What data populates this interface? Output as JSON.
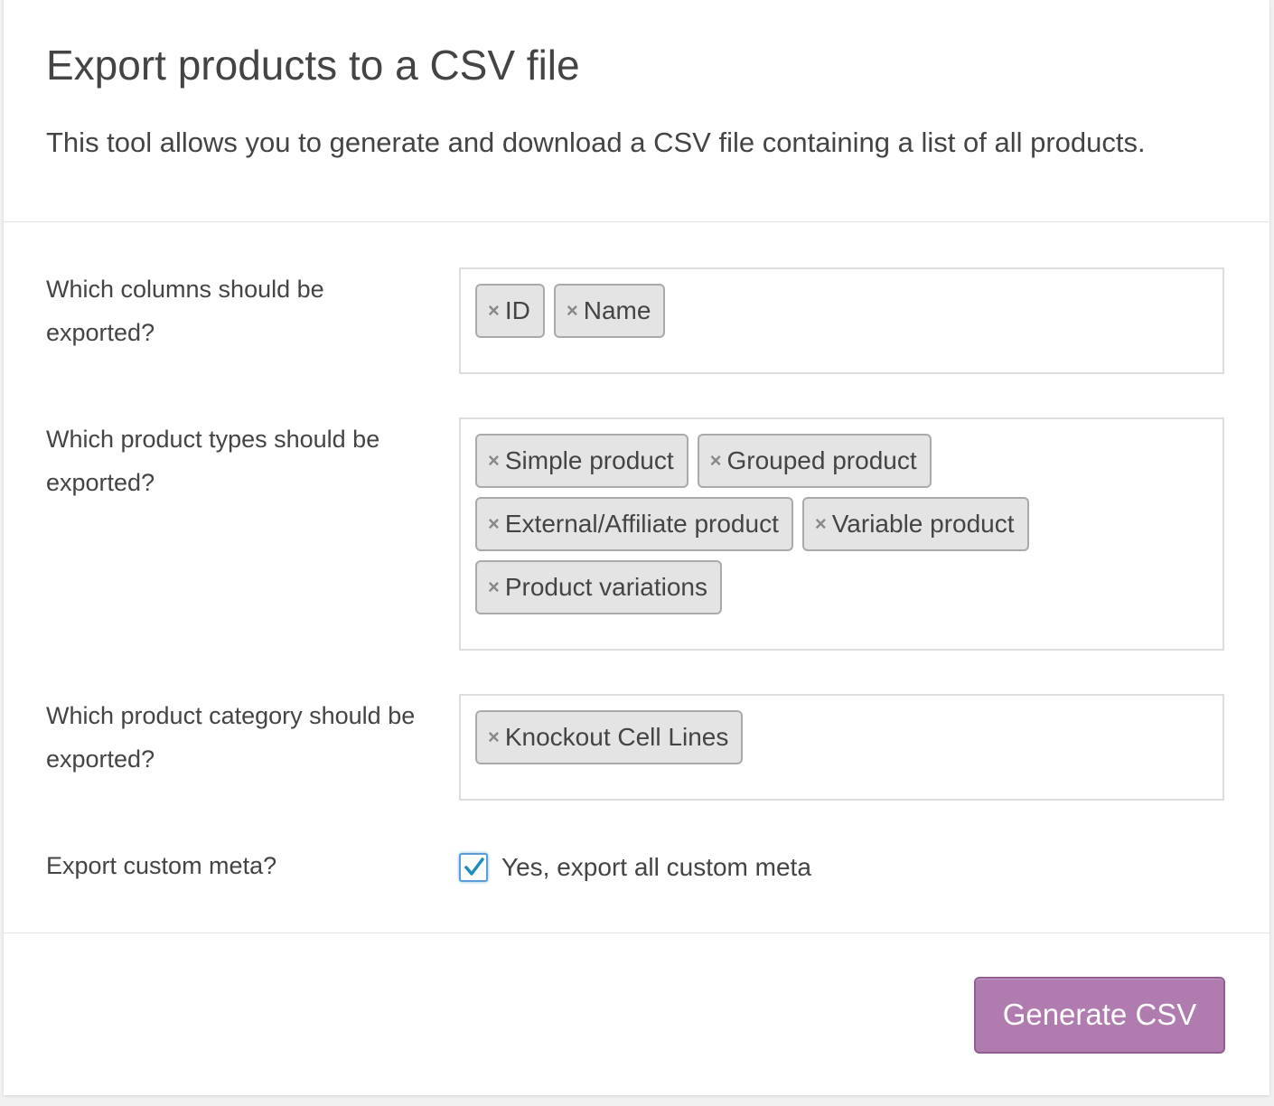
{
  "header": {
    "title": "Export products to a CSV file",
    "description": "This tool allows you to generate and download a CSV file containing a list of all products."
  },
  "columns": {
    "label": "Which columns should be exported?",
    "tokens": [
      "ID",
      "Name"
    ]
  },
  "product_types": {
    "label": "Which product types should be exported?",
    "tokens": [
      "Simple product",
      "Grouped product",
      "External/Affiliate product",
      "Variable product",
      "Product variations"
    ]
  },
  "category": {
    "label": "Which product category should be exported?",
    "tokens": [
      "Knockout Cell Lines"
    ]
  },
  "custom_meta": {
    "label": "Export custom meta?",
    "checkbox_label": "Yes, export all custom meta",
    "checked": true
  },
  "actions": {
    "generate_label": "Generate CSV"
  },
  "colors": {
    "accent": "#b07cb0",
    "focus": "#5b9dd9",
    "token_bg": "#e4e4e4"
  },
  "icons": {
    "remove": "close-icon",
    "check": "checkmark-icon"
  }
}
